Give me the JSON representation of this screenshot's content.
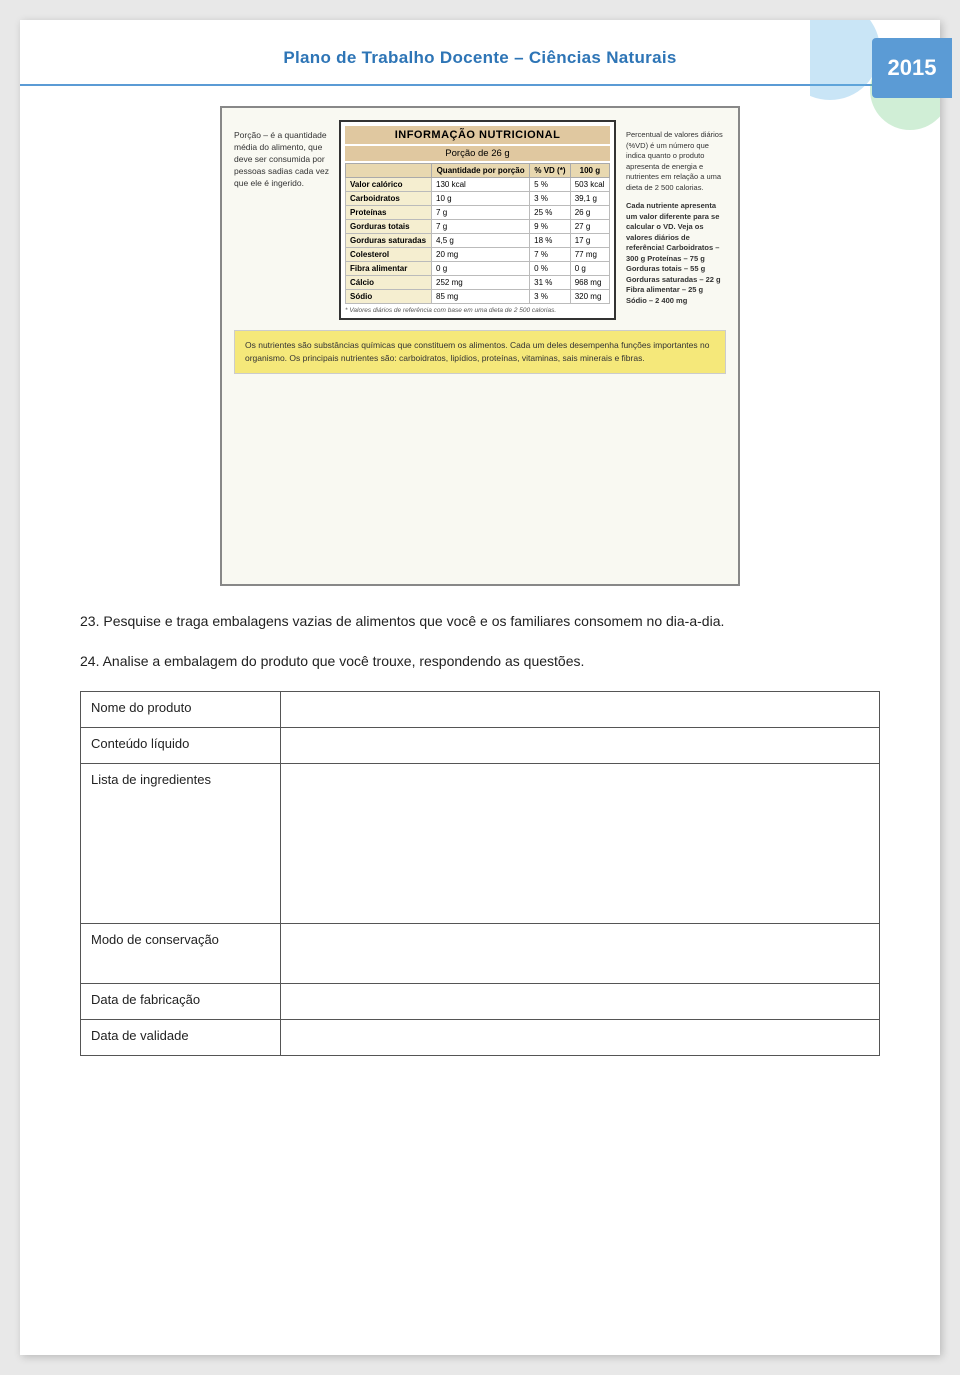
{
  "page": {
    "title": "Plano de Trabalho Docente – Ciências Naturais",
    "year": "2015"
  },
  "nutrition_info": {
    "title": "INFORMAÇÃO NUTRICIONAL",
    "porcao_label": "Porção de 26 g",
    "columns": [
      "Quantidade por porção",
      "% VD (*)",
      "100 g"
    ],
    "rows": [
      {
        "label": "Valor calórico",
        "col1": "130 kcal",
        "col2": "5 %",
        "col3": "503 kcal"
      },
      {
        "label": "Carboidratos",
        "col1": "10 g",
        "col2": "3 %",
        "col3": "39,1 g"
      },
      {
        "label": "Proteínas",
        "col1": "7 g",
        "col2": "25 %",
        "col3": "26 g"
      },
      {
        "label": "Gorduras totais",
        "col1": "7 g",
        "col2": "9 %",
        "col3": "27 g"
      },
      {
        "label": "Gorduras saturadas",
        "col1": "4,5 g",
        "col2": "18 %",
        "col3": "17 g"
      },
      {
        "label": "Colesterol",
        "col1": "20 mg",
        "col2": "7 %",
        "col3": "77 mg"
      },
      {
        "label": "Fibra alimentar",
        "col1": "0 g",
        "col2": "0 %",
        "col3": "0 g"
      },
      {
        "label": "Cálcio",
        "col1": "252 mg",
        "col2": "31 %",
        "col3": "968 mg"
      },
      {
        "label": "Sódio",
        "col1": "85 mg",
        "col2": "3 %",
        "col3": "320 mg"
      }
    ],
    "note": "* Valores diários de referência com base em uma dieta de 2 500 calorias.",
    "left_text": "Porção – é a quantidade média do alimento, que deve ser consumida por pessoas sadias cada vez que ele é ingerido.",
    "right_text_1": "Percentual de valores diários (%VD) é um número que indica quanto o produto apresenta de energia e nutrientes em relação a uma dieta de 2 500 calorias.",
    "right_text_2": "Cada nutriente apresenta um valor diferente para se calcular o VD. Veja os valores diários de referência! Carboidratos – 300 g Proteínas – 75 g Gorduras totais – 55 g Gorduras saturadas – 22 g Fibra alimentar – 25 g Sódio – 2 400 mg",
    "yellow_text": "Os nutrientes são substâncias químicas que constituem os alimentos. Cada um deles desempenha funções importantes no organismo. Os principais nutrientes são: carboidratos, lipídios, proteínas, vitaminas, sais minerais e fibras."
  },
  "questions": {
    "q23": {
      "number": "23.",
      "text": "Pesquise e traga embalagens vazias de alimentos que você e os familiares consomem no dia-a-dia."
    },
    "q24": {
      "number": "24.",
      "text": "Analise a embalagem do produto que você trouxe, respondendo as questões."
    }
  },
  "table": {
    "rows": [
      {
        "label": "Nome do produto",
        "height": "short"
      },
      {
        "label": "Conteúdo líquido",
        "height": "short"
      },
      {
        "label": "Lista de ingredientes",
        "height": "tall"
      },
      {
        "label": "Modo de conservação",
        "height": "medium"
      },
      {
        "label": "Data de fabricação",
        "height": "short"
      },
      {
        "label": "Data de validade",
        "height": "short"
      }
    ]
  }
}
